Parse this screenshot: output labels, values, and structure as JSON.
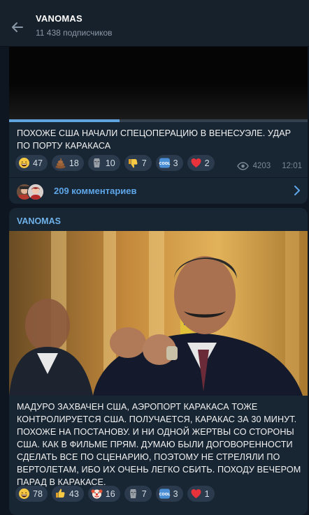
{
  "header": {
    "title": "VANOMAS",
    "subtitle": "11 438 подписчиков"
  },
  "messages": [
    {
      "video_progress": 0.37,
      "text": "ПОХОЖЕ США НАЧАЛИ СПЕЦОПЕРАЦИЮ В ВЕНЕСУЭЛЕ. УДАР ПО ПОРТУ КАРАКАСА",
      "reactions": [
        {
          "icon": "grinning-face-icon",
          "count": "47"
        },
        {
          "icon": "pile-of-poo-icon",
          "count": "18"
        },
        {
          "icon": "moai-icon",
          "count": "10"
        },
        {
          "icon": "thumbs-down-icon",
          "count": "7"
        },
        {
          "icon": "cool-button-icon",
          "count": "3"
        },
        {
          "icon": "red-heart-icon",
          "count": "2"
        }
      ],
      "views": "4203",
      "time": "12:01",
      "comments_label": "209 комментариев"
    },
    {
      "author": "VANOMAS",
      "text": "МАДУРО ЗАХВАЧЕН США, АЭРОПОРТ КАРАКАСА ТОЖЕ КОНТРОЛИРУЕТСЯ США. ПОЛУЧАЕТСЯ, КАРАКАС ЗА 30 МИНУТ. ПОХОЖЕ НА ПОСТАНОВУ. И НИ ОДНОЙ ЖЕРТВЫ СО СТОРОНЫ США. КАК В ФИЛЬМЕ ПРЯМ. ДУМАЮ БЫЛИ ДОГОВОРЕННОСТИ СДЕЛАТЬ ВСЕ ПО СЦЕНАРИЮ, ПОЭТОМУ НЕ СТРЕЛЯЛИ ПО ВЕРТОЛЕТАМ, ИБО ИХ ОЧЕНЬ ЛЕГКО СБИТЬ. ПОХОДУ ВЕЧЕРОМ ПАРАД В КАРАКАСЕ.",
      "reactions": [
        {
          "icon": "grinning-face-icon",
          "count": "78"
        },
        {
          "icon": "thumbs-up-icon",
          "count": "43"
        },
        {
          "icon": "clown-face-icon",
          "count": "16"
        },
        {
          "icon": "moai-icon",
          "count": "7"
        },
        {
          "icon": "cool-button-icon",
          "count": "3"
        },
        {
          "icon": "red-heart-icon",
          "count": "1"
        }
      ]
    }
  ],
  "colors": {
    "background": "#0e1621",
    "header": "#17212b",
    "bubble": "#182533",
    "reaction_pill": "#2b3b4d",
    "accent": "#5ea6e8",
    "author": "#6fb2ea",
    "progress": "#5fa4df"
  }
}
